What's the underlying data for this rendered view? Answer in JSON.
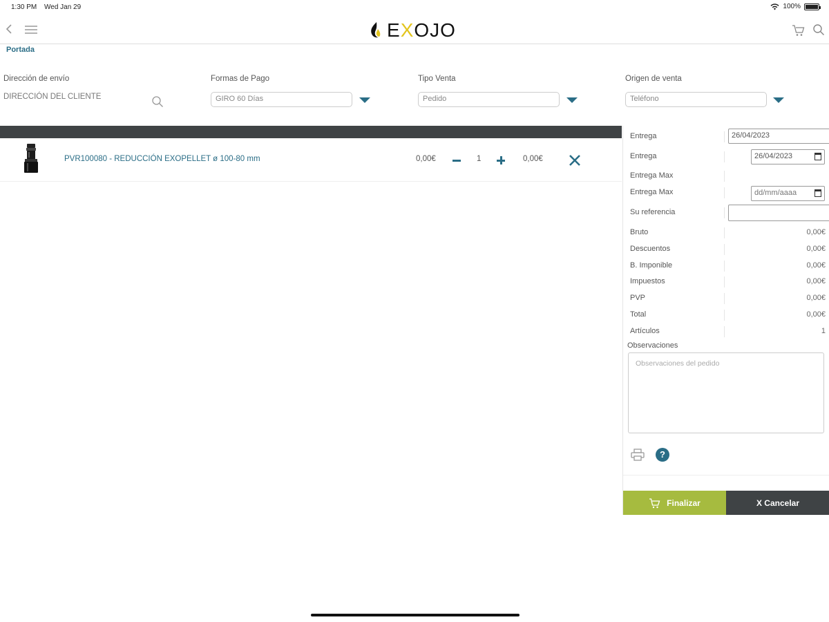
{
  "status_bar": {
    "time": "1:30 PM",
    "date": "Wed Jan 29",
    "battery": "100%"
  },
  "header": {
    "logo_text_pre": "E",
    "logo_text_x": "X",
    "logo_text_post": "OJO"
  },
  "breadcrumb": "Portada",
  "fields": {
    "shipping": {
      "label": "Dirección de envío",
      "value": "DIRECCIÓN DEL CLIENTE"
    },
    "payment": {
      "label": "Formas de Pago",
      "value": "GIRO 60 Días"
    },
    "sale_type": {
      "label": "Tipo Venta",
      "value": "Pedido"
    },
    "sale_origin": {
      "label": "Origen de venta",
      "value": "Teléfono"
    }
  },
  "line_item": {
    "name": "PVR100080 - REDUCCIÓN EXOPELLET ø 100-80 mm",
    "price": "0,00€",
    "quantity": "1",
    "total": "0,00€"
  },
  "panel": {
    "delivery_label": "Entrega",
    "delivery_value": "26/04/2023",
    "delivery2_label": "Entrega",
    "delivery2_value": "26/04/2023",
    "delivery_max_label": "Entrega Max",
    "delivery_max2_label": "Entrega Max",
    "delivery_max2_placeholder": "dd/mm/aaaa",
    "reference_label": "Su referencia",
    "totals": [
      {
        "label": "Bruto",
        "value": "0,00€"
      },
      {
        "label": "Descuentos",
        "value": "0,00€"
      },
      {
        "label": "B. Imponible",
        "value": "0,00€"
      },
      {
        "label": "Impuestos",
        "value": "0,00€"
      },
      {
        "label": "PVP",
        "value": "0,00€"
      },
      {
        "label": "Total",
        "value": "0,00€"
      },
      {
        "label": "Artículos",
        "value": "1"
      }
    ],
    "observations_label": "Observaciones",
    "observations_placeholder": "Observaciones del pedido",
    "help_glyph": "?",
    "finish_label": "Finalizar",
    "cancel_label": "X Cancelar"
  },
  "colors": {
    "accent": "#2a6d86",
    "finish": "#a6bb3f",
    "dark": "#3f4345",
    "logo_x": "#e3c51e"
  },
  "icons": [
    "back-icon",
    "menu-icon",
    "cart-icon",
    "search-icon",
    "calendar-icon",
    "print-icon",
    "help-icon",
    "remove-icon"
  ]
}
